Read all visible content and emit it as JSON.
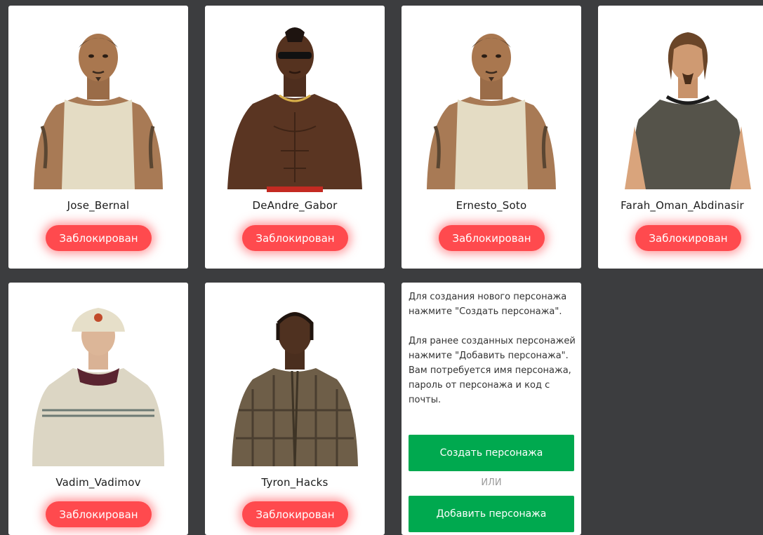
{
  "characters": [
    {
      "name": "Jose_Bernal",
      "status": "Заблокирован",
      "skin": "tank-top-tattoo"
    },
    {
      "name": "DeAndre_Gabor",
      "status": "Заблокирован",
      "skin": "shirtless-sunglasses"
    },
    {
      "name": "Ernesto_Soto",
      "status": "Заблокирован",
      "skin": "tank-top-tattoo"
    },
    {
      "name": "Farah_Oman_Abdinasir",
      "status": "Заблокирован",
      "skin": "grey-tshirt-longhair"
    },
    {
      "name": "Vadim_Vadimov",
      "status": "Заблокирован",
      "skin": "bucket-hat-jacket"
    },
    {
      "name": "Tyron_Hacks",
      "status": "Заблокирован",
      "skin": "plaid-shirt-braids"
    }
  ],
  "info_card": {
    "paragraph1": "Для создания нового персонажа нажмите \"Создать персонажа\".",
    "paragraph2": "Для ранее созданных персонажей нажмите \"Добавить персонажа\". Вам потребуется имя персонажа, пароль от персонажа и код с почты.",
    "create_label": "Создать персонажа",
    "or_label": "ИЛИ",
    "add_label": "Добавить персонажа"
  },
  "colors": {
    "background": "#3c3d3f",
    "card": "#ffffff",
    "blocked_button": "#ff4a4e",
    "action_button": "#00a94f"
  }
}
